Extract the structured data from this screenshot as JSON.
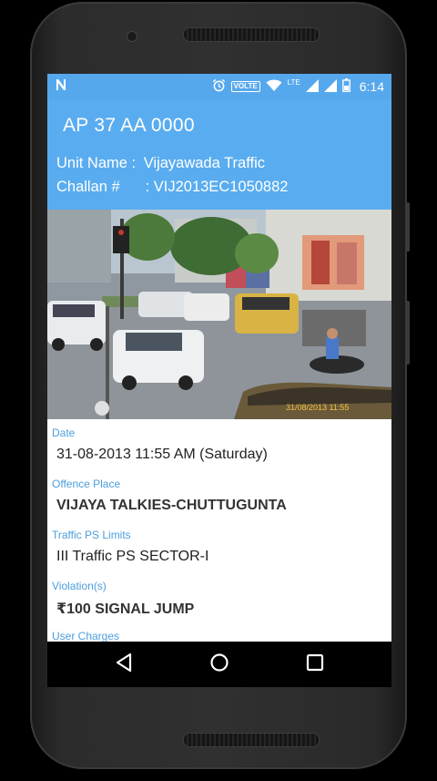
{
  "status_bar": {
    "time": "6:14",
    "volte_badge": "VOLTE",
    "lte_label": "LTE",
    "icons": [
      "notification-n-icon",
      "alarm-icon",
      "volte-icon",
      "wifi-icon",
      "signal-icon",
      "signal-icon",
      "battery-icon"
    ]
  },
  "challan": {
    "vehicle_number": "AP 37 AA 0000",
    "unit_label": "Unit Name :",
    "unit_value": "Vijayawada Traffic",
    "challan_label": "Challan #",
    "challan_value": ": VIJ2013EC1050882",
    "photo_timestamp": "31/08/2013 11:55"
  },
  "details": [
    {
      "label": "Date",
      "value": "31-08-2013 11:55 AM (Saturday)"
    },
    {
      "label": "Offence Place",
      "value": "VIJAYA TALKIES-CHUTTUGUNTA"
    },
    {
      "label": "Traffic PS Limits",
      "value": "III Traffic PS SECTOR-I"
    },
    {
      "label": "Violation(s)",
      "value": "₹100 SIGNAL JUMP"
    },
    {
      "label": "User Charges",
      "value": ""
    }
  ],
  "nav": {
    "back": "back-icon",
    "home": "home-icon",
    "recents": "recents-icon"
  },
  "colors": {
    "header": "#59acef",
    "status": "#56a8ed",
    "label": "#4b9ede"
  }
}
